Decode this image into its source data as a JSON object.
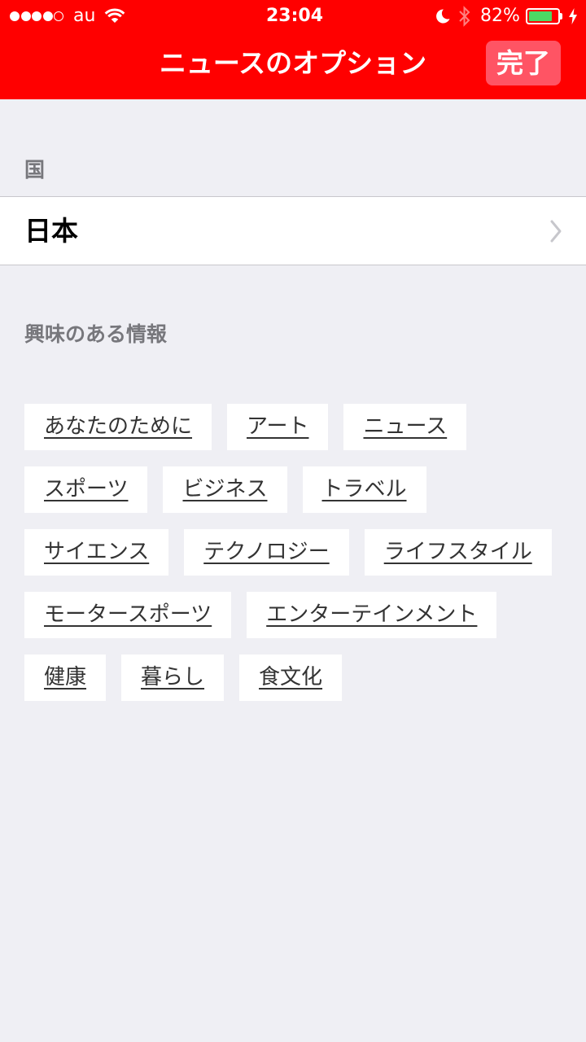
{
  "status_bar": {
    "carrier": "au",
    "time": "23:04",
    "battery_text": "82%",
    "battery_level": 0.82,
    "signal_strength": 4,
    "signal_max": 5,
    "icons": {
      "wifi": "wifi-icon",
      "do_not_disturb": "moon-icon",
      "bluetooth": "bluetooth-icon",
      "battery": "battery-icon",
      "charging": "charging-bolt-icon"
    }
  },
  "nav_bar": {
    "title": "ニュースのオプション",
    "done_label": "完了"
  },
  "country_section": {
    "header": "国",
    "selected_country": "日本",
    "disclosure_icon": "chevron-right-icon"
  },
  "interests_section": {
    "header": "興味のある情報",
    "topics": [
      "あなたのために",
      "アート",
      "ニュース",
      "スポーツ",
      "ビジネス",
      "トラベル",
      "サイエンス",
      "テクノロジー",
      "ライフスタイル",
      "モータースポーツ",
      "エンターテインメント",
      "健康",
      "暮らし",
      "食文化"
    ]
  },
  "colors": {
    "accent": "#ff0000",
    "done_button_background": "#ff5464",
    "page_background": "#efeff4",
    "section_header_text": "#77777c",
    "battery_fill": "#4cd964",
    "topic_text": "#333333"
  }
}
